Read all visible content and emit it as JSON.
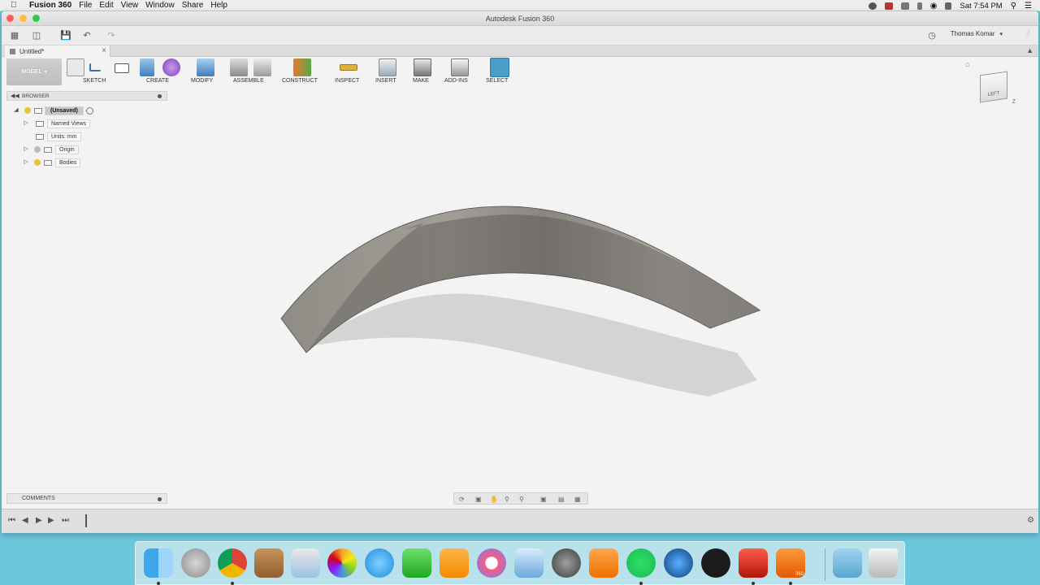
{
  "menubar": {
    "app_name": "Fusion 360",
    "items": [
      "File",
      "Edit",
      "View",
      "Window",
      "Share",
      "Help"
    ],
    "clock": "Sat 7:54 PM"
  },
  "window": {
    "title": "Autodesk Fusion 360",
    "user": "Thomas Komar",
    "tab_title": "Untitled*"
  },
  "ribbon": {
    "workspace": "MODEL",
    "groups": [
      "SKETCH",
      "CREATE",
      "MODIFY",
      "ASSEMBLE",
      "CONSTRUCT",
      "INSPECT",
      "INSERT",
      "MAKE",
      "ADD-INS",
      "SELECT"
    ]
  },
  "browser": {
    "header": "BROWSER",
    "root": "(Unsaved)",
    "items": [
      "Named Views",
      "Units: mm",
      "Origin",
      "Bodies"
    ]
  },
  "viewcube": {
    "face": "LEFT",
    "axis": "Z"
  },
  "comments": {
    "label": "COMMENTS"
  },
  "colors": {
    "accent": "#4a9fc8",
    "desktop": "#6cc6dc",
    "model_surface": "#8e8b84",
    "shadow": "#c9c9c9"
  },
  "dock": {
    "apps": [
      "finder-icon",
      "launchpad-icon",
      "chrome-icon",
      "contacts-icon",
      "preview-icon",
      "photos-icon",
      "messages-icon",
      "facetime-icon",
      "pages-icon",
      "itunes-icon",
      "keynote-icon",
      "system-preferences-icon",
      "ibooks-icon",
      "spotify-icon",
      "quicktime-icon",
      "vectorworks-icon",
      "filezilla-icon",
      "fusion360-icon",
      "downloads-icon",
      "trash-icon"
    ],
    "fusion_badge": "360"
  }
}
